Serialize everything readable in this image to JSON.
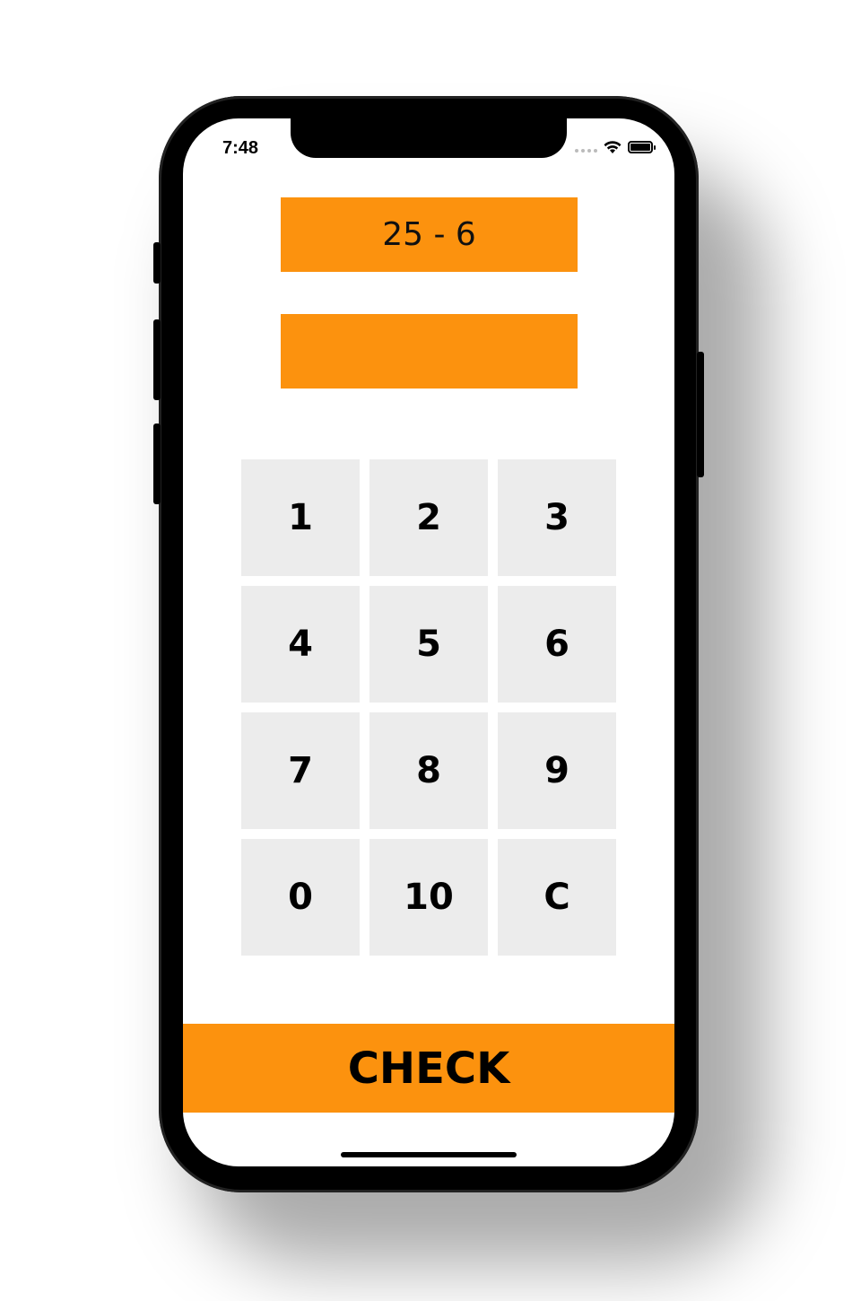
{
  "status_bar": {
    "time": "7:48",
    "icons": [
      "signal-dots-icon",
      "wifi-icon",
      "battery-icon"
    ]
  },
  "question": {
    "text": "25 - 6"
  },
  "answer": {
    "text": ""
  },
  "keypad": {
    "keys": [
      "1",
      "2",
      "3",
      "4",
      "5",
      "6",
      "7",
      "8",
      "9",
      "0",
      "10",
      "C"
    ]
  },
  "check_button": {
    "label": "CHECK"
  },
  "colors": {
    "accent": "#fc920e",
    "key_background": "#ececec",
    "text": "#000000"
  }
}
